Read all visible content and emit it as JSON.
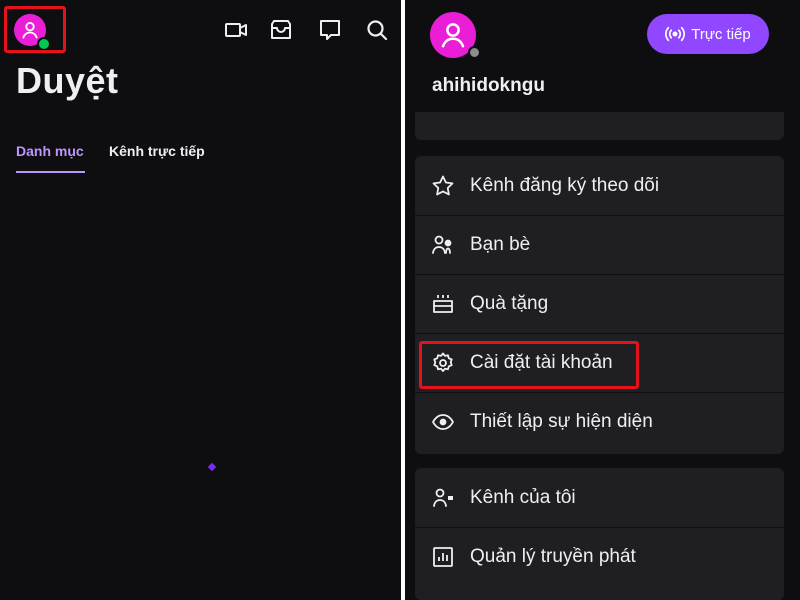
{
  "left": {
    "title": "Duyệt",
    "tabs": [
      {
        "label": "Danh mục",
        "active": true
      },
      {
        "label": "Kênh trực tiếp",
        "active": false
      }
    ],
    "icons": [
      "user-avatar-icon",
      "video-icon",
      "inbox-icon",
      "chat-icon",
      "search-icon"
    ]
  },
  "right": {
    "username": "ahihidokngu",
    "live_button": "Trực tiếp",
    "menu": [
      {
        "label": "Kênh đăng ký theo dõi",
        "icon": "star-icon"
      },
      {
        "label": "Bạn bè",
        "icon": "friends-icon"
      },
      {
        "label": "Quà tặng",
        "icon": "gift-icon"
      },
      {
        "label": "Cài đặt tài khoản",
        "icon": "gear-icon"
      },
      {
        "label": "Thiết lập sự hiện diện",
        "icon": "eye-icon"
      }
    ],
    "menu2": [
      {
        "label": "Kênh của tôi",
        "icon": "my-channel-icon"
      },
      {
        "label": "Quản lý truyền phát",
        "icon": "dashboard-icon"
      }
    ]
  },
  "colors": {
    "accent": "#bf94ff",
    "brand_purple": "#9147ff",
    "avatar_pink": "#e91ed6",
    "online_green": "#00c853",
    "highlight_red": "#e3121b",
    "background": "#0e0e10",
    "card": "#1f1f23"
  }
}
